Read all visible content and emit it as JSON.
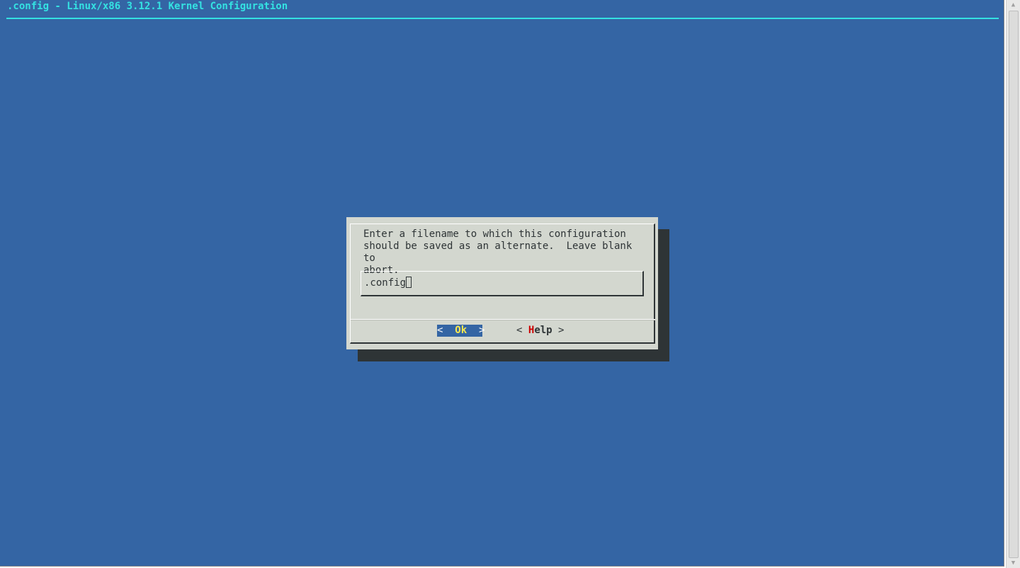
{
  "terminal": {
    "title": ".config - Linux/x86 3.12.1 Kernel Configuration",
    "background_color": "#3465a4",
    "title_color": "#34e2e2"
  },
  "dialog": {
    "prompt": "Enter a filename to which this configuration\nshould be saved as an alternate.  Leave blank to\nabort.",
    "input_value": ".config",
    "buttons": {
      "ok": {
        "left_bracket": "<",
        "label": "Ok",
        "right_bracket": ">",
        "selected": true
      },
      "help": {
        "left_bracket": "<",
        "hotkey": "H",
        "label_rest": "elp",
        "right_bracket": ">",
        "hotkey_color": "#cc0000"
      }
    }
  },
  "scrollbar": {
    "up_arrow": "▲",
    "down_arrow": "▼"
  }
}
